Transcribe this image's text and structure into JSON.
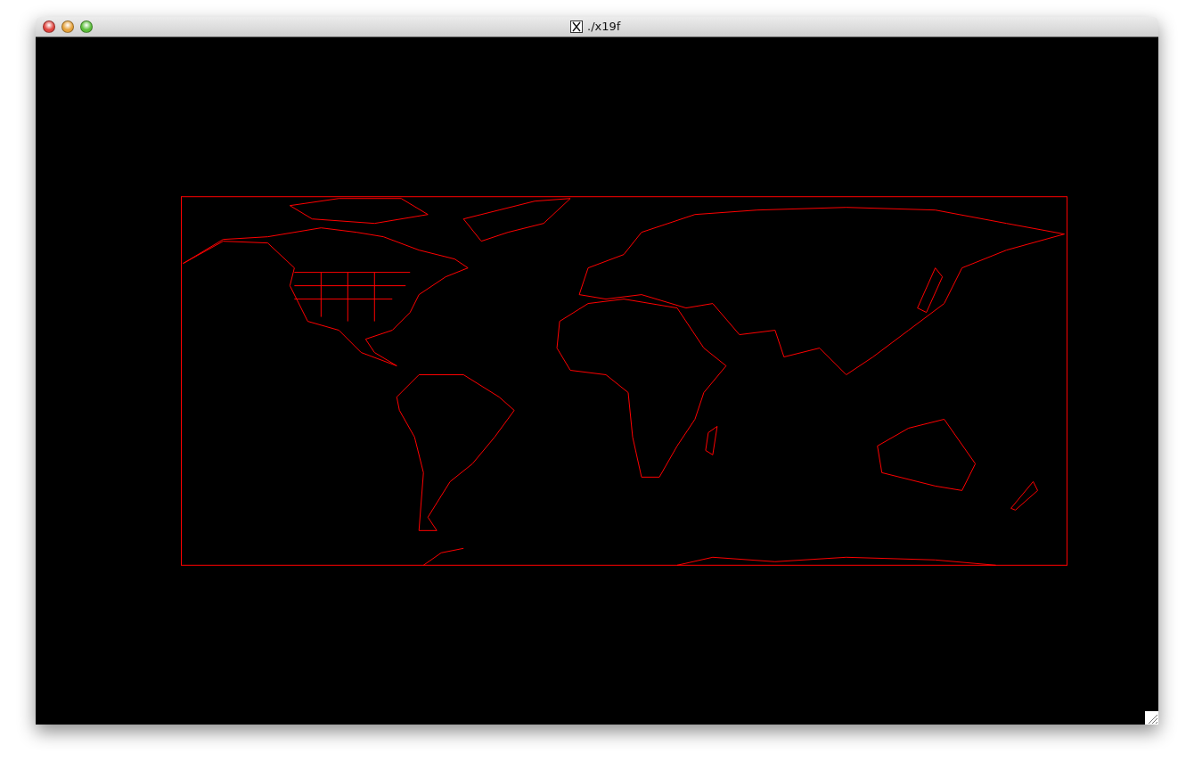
{
  "window": {
    "title": "./x19f"
  }
}
